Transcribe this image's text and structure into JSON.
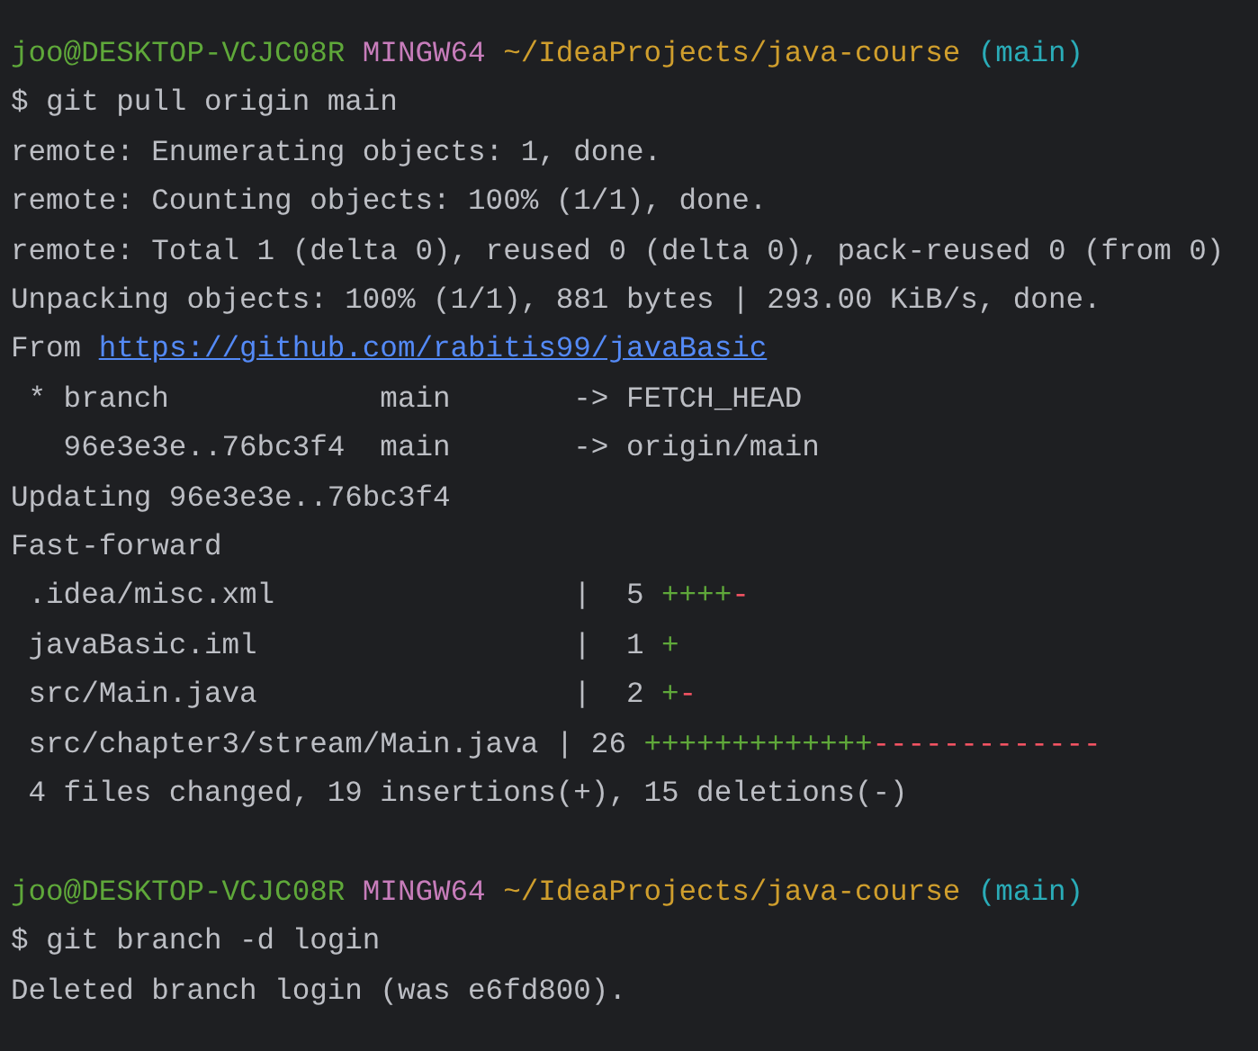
{
  "terminal": {
    "lines": [
      {
        "kind": "prompt",
        "segments": [
          {
            "kind": "user",
            "text": "joo@DESKTOP-VCJC08R"
          },
          {
            "kind": "shell",
            "text": " MINGW64"
          },
          {
            "kind": "path",
            "text": " ~/IdeaProjects/java-course"
          },
          {
            "kind": "branch",
            "text": " (main)"
          }
        ]
      },
      {
        "kind": "command",
        "segments": [
          {
            "kind": "text",
            "text": "$ git pull origin main"
          }
        ]
      },
      {
        "kind": "output",
        "segments": [
          {
            "kind": "text",
            "text": "remote: Enumerating objects: 1, done."
          }
        ]
      },
      {
        "kind": "output",
        "segments": [
          {
            "kind": "text",
            "text": "remote: Counting objects: 100% (1/1), done."
          }
        ]
      },
      {
        "kind": "output",
        "segments": [
          {
            "kind": "text",
            "text": "remote: Total 1 (delta 0), reused 0 (delta 0), pack-reused 0 (from 0)"
          }
        ]
      },
      {
        "kind": "output",
        "segments": [
          {
            "kind": "text",
            "text": "Unpacking objects: 100% (1/1), 881 bytes | 293.00 KiB/s, done."
          }
        ]
      },
      {
        "kind": "output",
        "segments": [
          {
            "kind": "text",
            "text": "From "
          },
          {
            "kind": "link",
            "text": "https://github.com/rabitis99/javaBasic"
          }
        ]
      },
      {
        "kind": "output",
        "segments": [
          {
            "kind": "text",
            "text": " * branch            main       -> FETCH_HEAD"
          }
        ]
      },
      {
        "kind": "output",
        "segments": [
          {
            "kind": "text",
            "text": "   96e3e3e..76bc3f4  main       -> origin/main"
          }
        ]
      },
      {
        "kind": "output",
        "segments": [
          {
            "kind": "text",
            "text": "Updating 96e3e3e..76bc3f4"
          }
        ]
      },
      {
        "kind": "output",
        "segments": [
          {
            "kind": "text",
            "text": "Fast-forward"
          }
        ]
      },
      {
        "kind": "diffstat",
        "segments": [
          {
            "kind": "text",
            "text": " .idea/misc.xml                 |  5 "
          },
          {
            "kind": "plus",
            "text": "++++"
          },
          {
            "kind": "minus",
            "text": "-"
          }
        ]
      },
      {
        "kind": "diffstat",
        "segments": [
          {
            "kind": "text",
            "text": " javaBasic.iml                  |  1 "
          },
          {
            "kind": "plus",
            "text": "+"
          }
        ]
      },
      {
        "kind": "diffstat",
        "segments": [
          {
            "kind": "text",
            "text": " src/Main.java                  |  2 "
          },
          {
            "kind": "plus",
            "text": "+"
          },
          {
            "kind": "minus",
            "text": "-"
          }
        ]
      },
      {
        "kind": "diffstat",
        "segments": [
          {
            "kind": "text",
            "text": " src/chapter3/stream/Main.java | 26 "
          },
          {
            "kind": "plus",
            "text": "+++++++++++++"
          },
          {
            "kind": "minus",
            "text": "-------------"
          }
        ]
      },
      {
        "kind": "output",
        "segments": [
          {
            "kind": "text",
            "text": " 4 files changed, 19 insertions(+), 15 deletions(-)"
          }
        ]
      },
      {
        "kind": "blank"
      },
      {
        "kind": "prompt",
        "segments": [
          {
            "kind": "user",
            "text": "joo@DESKTOP-VCJC08R"
          },
          {
            "kind": "shell",
            "text": " MINGW64"
          },
          {
            "kind": "path",
            "text": " ~/IdeaProjects/java-course"
          },
          {
            "kind": "branch",
            "text": " (main)"
          }
        ]
      },
      {
        "kind": "command",
        "segments": [
          {
            "kind": "text",
            "text": "$ git branch -d login"
          }
        ]
      },
      {
        "kind": "output",
        "segments": [
          {
            "kind": "text",
            "text": "Deleted branch login (was e6fd800)."
          }
        ]
      }
    ]
  }
}
